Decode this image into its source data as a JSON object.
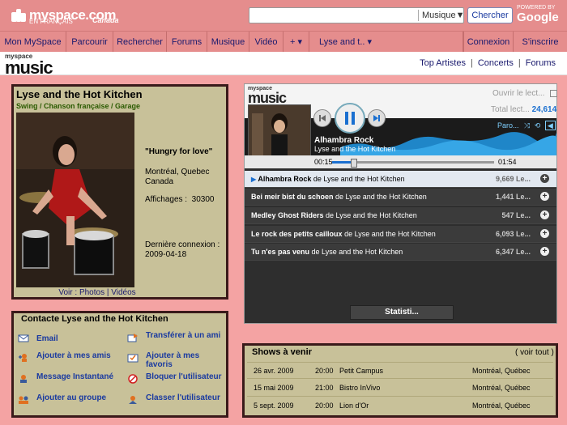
{
  "header": {
    "logo_text": "myspace.com",
    "logo_sub": "EN FRANÇAIS",
    "logo_country": "Canada",
    "search": {
      "value": "",
      "placeholder": "",
      "category": "Musique▼",
      "button": "Chercher"
    },
    "powered_by": "POWERED BY",
    "google": "Google"
  },
  "nav": {
    "items": [
      {
        "label": "Mon MySpace"
      },
      {
        "label": "Parcourir"
      },
      {
        "label": "Rechercher"
      },
      {
        "label": "Forums"
      },
      {
        "label": "Musique"
      },
      {
        "label": "Vidéo"
      },
      {
        "label": "+ ▾"
      },
      {
        "label": "Lyse and t.. ▾"
      },
      {
        "label": "Connexion"
      },
      {
        "label": "S'inscrire"
      }
    ]
  },
  "music_header": {
    "logo_small": "myspace",
    "logo_big": "music",
    "links": [
      "Top Artistes",
      "Concerts",
      "Forums"
    ]
  },
  "profile": {
    "name": "Lyse and the Hot Kitchen",
    "genre": "Swing / Chanson française / Garage",
    "quote": "\"Hungry for love\"",
    "city": "Montréal, Quebec",
    "country": "Canada",
    "views_label": "Affichages :",
    "views": "30300",
    "last_login_label": "Dernière connexion :",
    "last_login": "2009-04-18",
    "photo_links": "Voir : Photos | Vidéos"
  },
  "contact": {
    "title": "Contacte Lyse and the Hot Kitchen",
    "items": [
      {
        "label": "Email",
        "icon": "envelope-icon"
      },
      {
        "label": "Transférer à un ami",
        "icon": "forward-icon"
      },
      {
        "label": "Ajouter à mes amis",
        "icon": "add-friend-icon"
      },
      {
        "label": "Ajouter à mes favoris",
        "icon": "favorites-icon"
      },
      {
        "label": "Message Instantané",
        "icon": "im-icon"
      },
      {
        "label": "Bloquer l'utilisateur",
        "icon": "block-icon"
      },
      {
        "label": "Ajouter au groupe",
        "icon": "group-icon"
      },
      {
        "label": "Classer l'utilisateur",
        "icon": "rank-icon"
      }
    ]
  },
  "player": {
    "logo_small": "myspace",
    "logo_big": "music",
    "open_label": "Ouvrir le lect...",
    "total_label": "Total lect...",
    "total_value": "24,614",
    "par_label": "Paro...",
    "now_playing_song": "Alhambra Rock",
    "now_playing_artist": "Lyse and the Hot Kitchen",
    "elapsed": "00:15",
    "duration": "01:54",
    "progress": 0.13,
    "tracks": [
      {
        "title": "Alhambra Rock",
        "by": "de Lyse and the Hot Kitchen",
        "plays": "9,669 Le..."
      },
      {
        "title": "Bei meir bist du schoen",
        "by": "de Lyse and the Hot Kitchen",
        "plays": "1,441 Le..."
      },
      {
        "title": "Medley Ghost Riders",
        "by": "de Lyse and the Hot Kitchen",
        "plays": "547 Le..."
      },
      {
        "title": "Le rock des petits cailloux",
        "by": "de Lyse and the Hot Kitchen",
        "plays": "6,093 Le..."
      },
      {
        "title": "Tu n'es pas venu",
        "by": "de Lyse and the Hot Kitchen",
        "plays": "6,347 Le..."
      }
    ],
    "stats_button": "Statisti..."
  },
  "shows": {
    "title": "Shows à venir",
    "see_all": "( voir tout )",
    "items": [
      {
        "date": "26 avr. 2009",
        "time": "20:00",
        "venue": "Petit Campus",
        "city": "Montréal, Québec"
      },
      {
        "date": "15 mai 2009",
        "time": "21:00",
        "venue": "Bistro InVivo",
        "city": "Montréal, Québec"
      },
      {
        "date": "5 sept. 2009",
        "time": "20:00",
        "venue": "Lion d'Or",
        "city": "Montréal, Québec"
      }
    ]
  }
}
